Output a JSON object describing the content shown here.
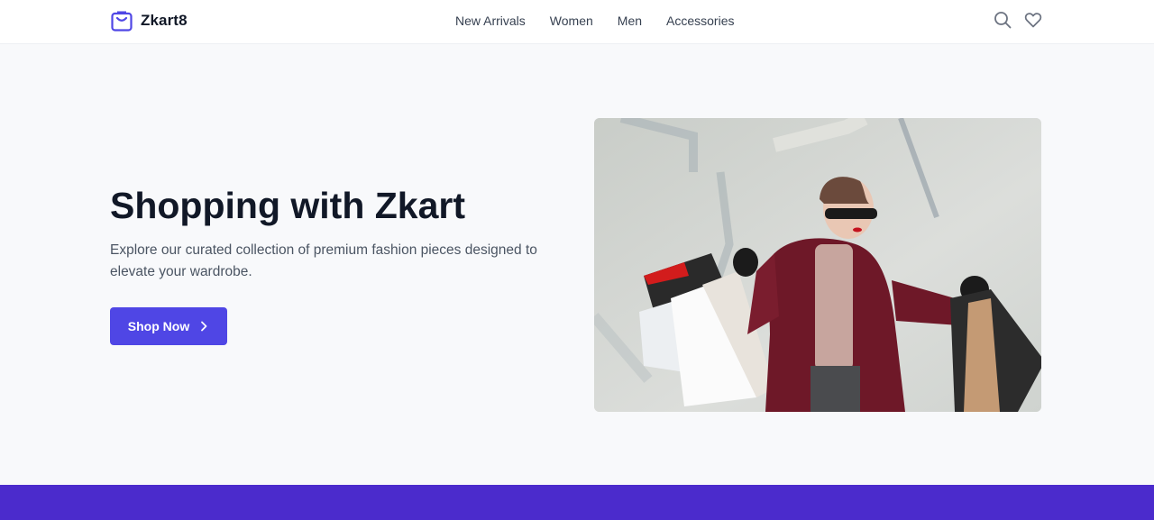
{
  "brand": {
    "name": "Zkart8",
    "icon": "shopping-bag-icon",
    "accent": "#4f46e5"
  },
  "nav": {
    "items": [
      {
        "label": "New Arrivals"
      },
      {
        "label": "Women"
      },
      {
        "label": "Men"
      },
      {
        "label": "Accessories"
      }
    ]
  },
  "header_icons": [
    "search-icon",
    "heart-icon"
  ],
  "hero": {
    "title": "Shopping with Zkart",
    "description": "Explore our curated collection of premium fashion pieces designed to elevate your wardrobe.",
    "cta_label": "Shop Now",
    "cta_icon": "chevron-right-icon",
    "image": "woman-with-shopping-bags-photo"
  },
  "colors": {
    "band": "#4b2bcc",
    "page_bg": "#f8f9fb"
  }
}
